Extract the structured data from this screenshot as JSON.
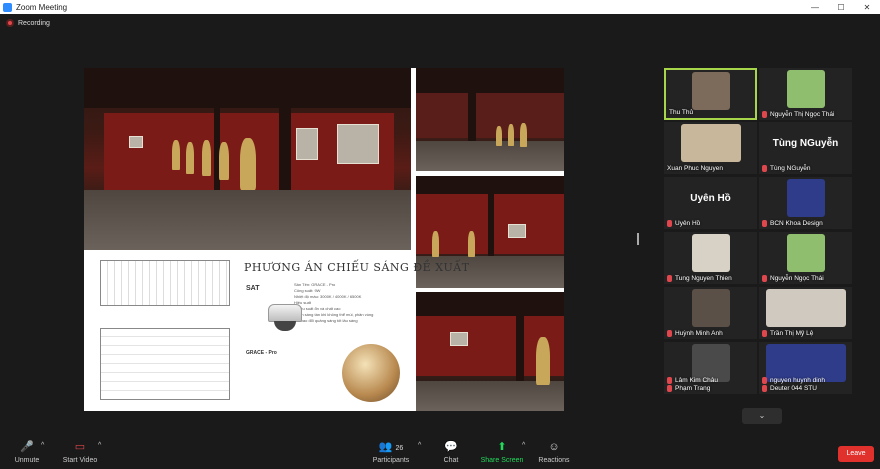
{
  "window": {
    "title": "Zoom Meeting",
    "minimize": "—",
    "maximize": "☐",
    "close": "✕"
  },
  "recording": {
    "label": "Recording"
  },
  "slide": {
    "heading": "PHƯƠNG ÁN CHIẾU SÁNG ĐỀ XUẤT",
    "brand": "SAT",
    "spec_lines": [
      "Sản Tên: GRACE - Pro",
      "Công suất: 9W",
      "Nhiệt độ màu: 3000K / 4000K / 6500K",
      "Hiệu suất",
      "- Hiệu suất ổn và chất cao",
      "- Ánh sáng tán khi không thể mùi, phân vùng",
      "mà bao đổi quảng sáng tốt lâu sáng"
    ],
    "model": "GRACE - Pro"
  },
  "participants": [
    {
      "name": "Thu Thủ",
      "type": "video",
      "active": true,
      "muted": false
    },
    {
      "name": "Nguyễn Thị Ngọc Thái",
      "type": "video",
      "active": false,
      "muted": true
    },
    {
      "name": "Xuan Phuc Nguyen",
      "type": "video",
      "active": false,
      "muted": false
    },
    {
      "name": "Tùng NGuyễn",
      "type": "name",
      "big": "Tùng NGuyễn",
      "active": false,
      "muted": true
    },
    {
      "name": "Uyên Hồ",
      "type": "name",
      "big": "Uyên Hồ",
      "active": false,
      "muted": true
    },
    {
      "name": "BCN Khoa Design",
      "type": "video",
      "active": false,
      "muted": true
    },
    {
      "name": "Tung Nguyen Thien",
      "type": "video",
      "active": false,
      "muted": true
    },
    {
      "name": "Nguyễn Ngọc Thái",
      "type": "video",
      "active": false,
      "muted": true
    },
    {
      "name": "Huỳnh Minh Anh",
      "type": "video",
      "active": false,
      "muted": true
    },
    {
      "name": "Trần Thị Mỹ Lệ",
      "type": "video",
      "active": false,
      "muted": true
    },
    {
      "name": "Lâm Kim Châu",
      "type": "video",
      "active": false,
      "muted": true
    },
    {
      "name": "nguyen huynh dinh",
      "type": "video",
      "active": false,
      "muted": true
    }
  ],
  "extra_names": {
    "left": "Phạm Trang",
    "right": "Deuter 044 STU"
  },
  "toolbar": {
    "unmute": "Unmute",
    "start_video": "Start Video",
    "participants": "Participants",
    "participants_count": "26",
    "chat": "Chat",
    "share_screen": "Share Screen",
    "reactions": "Reactions",
    "leave": "Leave"
  },
  "colors": {
    "accent": "#a8d64a",
    "leave": "#e0312d",
    "share": "#23d959",
    "muted": "#e0474c"
  }
}
